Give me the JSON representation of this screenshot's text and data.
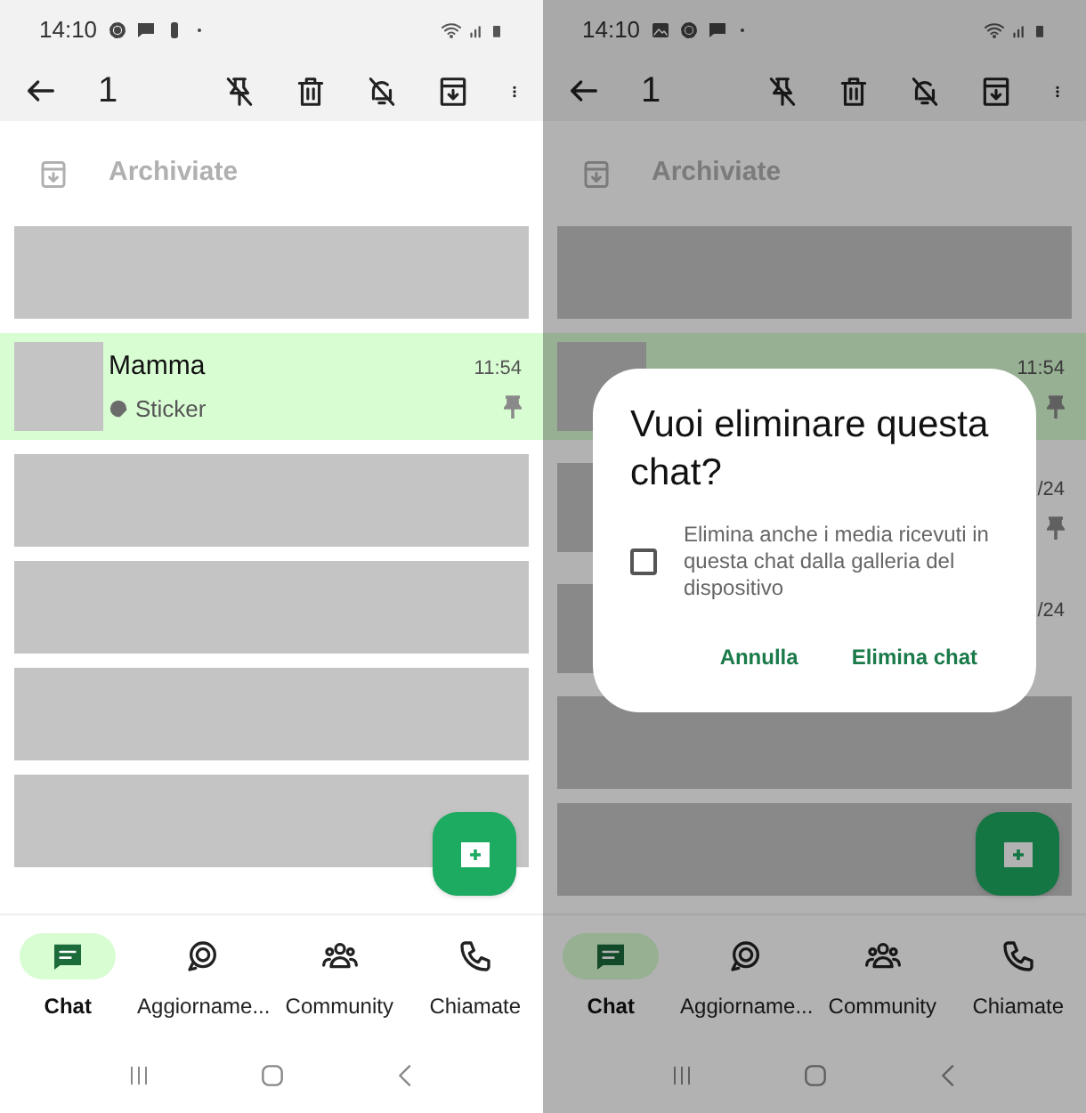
{
  "panels": [
    {
      "status_bar": {
        "time": "14:10"
      },
      "toolbar": {
        "count": "1"
      },
      "archived": {
        "label": "Archiviate"
      },
      "chats": [
        {
          "kind": "redacted"
        },
        {
          "kind": "chat",
          "name": "Mamma",
          "preview": "Sticker",
          "time": "11:54",
          "pinned": true,
          "selected": true
        },
        {
          "kind": "redacted"
        },
        {
          "kind": "redacted"
        },
        {
          "kind": "redacted"
        },
        {
          "kind": "redacted"
        }
      ],
      "nav": [
        {
          "label": "Chat",
          "selected": true
        },
        {
          "label": "Aggiorname...",
          "selected": false
        },
        {
          "label": "Community",
          "selected": false
        },
        {
          "label": "Chiamate",
          "selected": false
        }
      ]
    },
    {
      "status_bar": {
        "time": "14:10"
      },
      "toolbar": {
        "count": "1"
      },
      "archived": {
        "label": "Archiviate"
      },
      "chats": [
        {
          "kind": "redacted"
        },
        {
          "kind": "chat",
          "time": "11:54",
          "pinned": true,
          "selected": true
        },
        {
          "kind": "chat",
          "time": "/24",
          "pinned": true,
          "selected": false
        },
        {
          "kind": "chat",
          "time": "/24",
          "pinned": false,
          "selected": false
        },
        {
          "kind": "redacted"
        },
        {
          "kind": "redacted"
        }
      ],
      "nav": [
        {
          "label": "Chat",
          "selected": true
        },
        {
          "label": "Aggiorname...",
          "selected": false
        },
        {
          "label": "Community",
          "selected": false
        },
        {
          "label": "Chiamate",
          "selected": false
        }
      ],
      "dialog": {
        "title": "Vuoi eliminare questa chat?",
        "option": {
          "label": "Elimina anche i media ricevuti in questa chat dalla galleria del dispositivo",
          "checked": false
        },
        "buttons": [
          "Annulla",
          "Elimina chat"
        ]
      }
    }
  ]
}
